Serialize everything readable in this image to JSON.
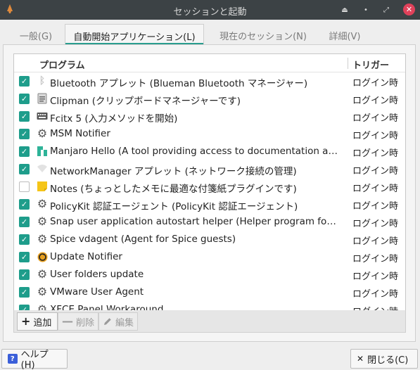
{
  "window": {
    "title": "セッションと起動",
    "buttons": {
      "keep_above": "⏏",
      "minimize": "•",
      "maximize": "⤢",
      "close": "✕"
    }
  },
  "tabs": [
    {
      "label": "一般(G)",
      "active": false
    },
    {
      "label": "自動開始アプリケーション(L)",
      "active": true
    },
    {
      "label": "現在のセッション(N)",
      "active": false
    },
    {
      "label": "詳細(V)",
      "active": false
    }
  ],
  "list": {
    "columns": {
      "program": "プログラム",
      "trigger": "トリガー"
    },
    "rows": [
      {
        "checked": true,
        "icon": "bluetooth-icon",
        "name": "Bluetooth アプレット (Blueman Bluetooth マネージャー)",
        "trigger": "ログイン時"
      },
      {
        "checked": true,
        "icon": "clipboard-icon",
        "name": "Clipman (クリップボードマネージャーです)",
        "trigger": "ログイン時"
      },
      {
        "checked": true,
        "icon": "keyboard-icon",
        "name": "Fcitx 5 (入力メソッドを開始)",
        "trigger": "ログイン時"
      },
      {
        "checked": true,
        "icon": "gear-icon",
        "name": "MSM Notifier",
        "trigger": "ログイン時"
      },
      {
        "checked": true,
        "icon": "manjaro-icon",
        "name": "Manjaro Hello (A tool providing access to documentation and support for new Manjaro users.)",
        "trigger": "ログイン時"
      },
      {
        "checked": true,
        "icon": "wifi-icon",
        "name": "NetworkManager アプレット (ネットワーク接続の管理)",
        "trigger": "ログイン時"
      },
      {
        "checked": false,
        "icon": "sticky-note-icon",
        "name": "Notes (ちょっとしたメモに最適な付箋紙プラグインです)",
        "trigger": "ログイン時"
      },
      {
        "checked": true,
        "icon": "gear-icon",
        "name": "PolicyKit 認証エージェント (PolicyKit 認証エージェント)",
        "trigger": "ログイン時"
      },
      {
        "checked": true,
        "icon": "gear-icon",
        "name": "Snap user application autostart helper (Helper program for launching snap applications)",
        "trigger": "ログイン時"
      },
      {
        "checked": true,
        "icon": "gear-icon",
        "name": "Spice vdagent (Agent for Spice guests)",
        "trigger": "ログイン時"
      },
      {
        "checked": true,
        "icon": "update-icon",
        "name": "Update Notifier",
        "trigger": "ログイン時"
      },
      {
        "checked": true,
        "icon": "gear-icon",
        "name": "User folders update",
        "trigger": "ログイン時"
      },
      {
        "checked": true,
        "icon": "gear-icon",
        "name": "VMware User Agent",
        "trigger": "ログイン時"
      },
      {
        "checked": true,
        "icon": "gear-icon",
        "name": "XFCE Panel Workaround",
        "trigger": "ログイン時"
      }
    ]
  },
  "toolbar": {
    "add_label": "追加",
    "remove_label": "削除",
    "edit_label": "編集"
  },
  "footer": {
    "help_label": "ヘルプ(H)",
    "close_label": "閉じる(C)"
  },
  "colors": {
    "accent": "#1e9d8b",
    "titlebar": "#3c4245",
    "close": "#e0415a"
  }
}
